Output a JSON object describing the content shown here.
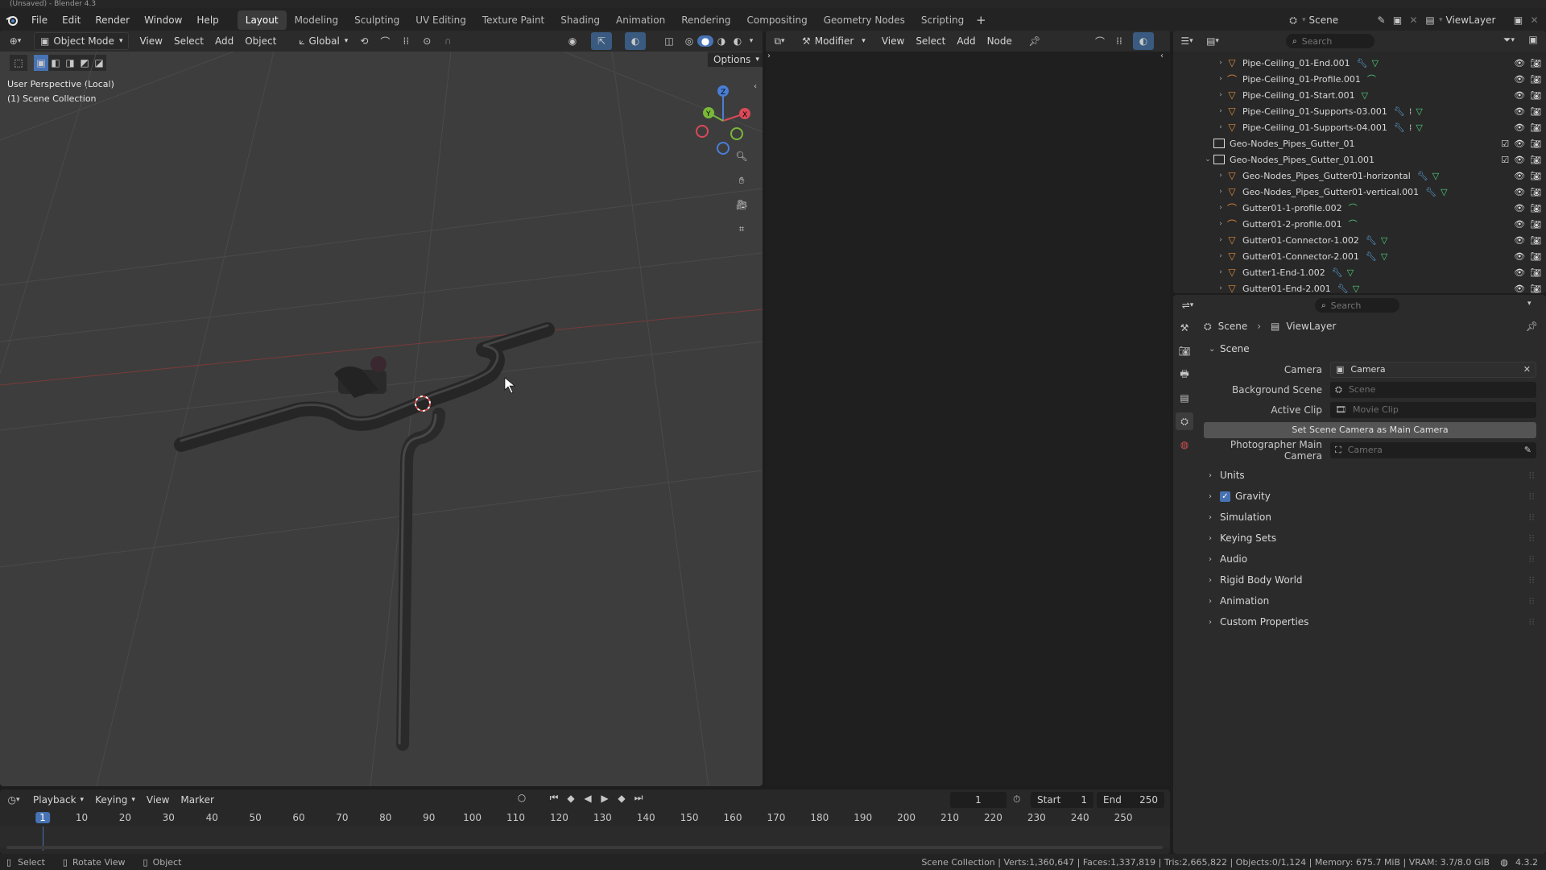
{
  "window": {
    "title": "(Unsaved) - Blender 4.3"
  },
  "topbar": {
    "menus": [
      "File",
      "Edit",
      "Render",
      "Window",
      "Help"
    ],
    "workspaces": [
      "Layout",
      "Modeling",
      "Sculpting",
      "UV Editing",
      "Texture Paint",
      "Shading",
      "Animation",
      "Rendering",
      "Compositing",
      "Geometry Nodes",
      "Scripting"
    ],
    "active_workspace": "Layout",
    "scene": "Scene",
    "view_layer": "ViewLayer"
  },
  "viewport": {
    "mode": "Object Mode",
    "menus": [
      "View",
      "Select",
      "Add",
      "Object"
    ],
    "orientation": "Global",
    "options_label": "Options",
    "overlay_line1": "User Perspective (Local)",
    "overlay_line2": "(1) Scene Collection"
  },
  "node_editor": {
    "type": "Modifier",
    "menus": [
      "View",
      "Select",
      "Add",
      "Node"
    ]
  },
  "outliner": {
    "search_placeholder": "Search",
    "rows": [
      {
        "name": "Pipe-Ceiling_01-End.001",
        "type": "mesh",
        "mods": "wrench,tri",
        "indent": 2
      },
      {
        "name": "Pipe-Ceiling_01-Profile.001",
        "type": "curve",
        "mods": "curve",
        "indent": 2
      },
      {
        "name": "Pipe-Ceiling_01-Start.001",
        "type": "mesh",
        "mods": "tri",
        "indent": 2
      },
      {
        "name": "Pipe-Ceiling_01-Supports-03.001",
        "type": "mesh",
        "mods": "wrench,grid,tri",
        "indent": 2
      },
      {
        "name": "Pipe-Ceiling_01-Supports-04.001",
        "type": "mesh",
        "mods": "wrench,grid,tri",
        "indent": 2
      },
      {
        "name": "Geo-Nodes_Pipes_Gutter_01",
        "type": "collection",
        "mods": "",
        "indent": 1
      },
      {
        "name": "Geo-Nodes_Pipes_Gutter_01.001",
        "type": "collection",
        "mods": "",
        "indent": 1
      },
      {
        "name": "Geo-Nodes_Pipes_Gutter01-horizontal",
        "type": "mesh",
        "mods": "wrench,tri",
        "indent": 2
      },
      {
        "name": "Geo-Nodes_Pipes_Gutter01-vertical.001",
        "type": "mesh",
        "mods": "wrench,tri",
        "indent": 2
      },
      {
        "name": "Gutter01-1-profile.002",
        "type": "curve",
        "mods": "curve",
        "indent": 2
      },
      {
        "name": "Gutter01-2-profile.001",
        "type": "curve",
        "mods": "curve",
        "indent": 2
      },
      {
        "name": "Gutter01-Connector-1.002",
        "type": "mesh",
        "mods": "wrench,tri",
        "indent": 2
      },
      {
        "name": "Gutter01-Connector-2.001",
        "type": "mesh",
        "mods": "wrench,tri",
        "indent": 2
      },
      {
        "name": "Gutter1-End-1.002",
        "type": "mesh",
        "mods": "wrench,tri",
        "indent": 2
      },
      {
        "name": "Gutter01-End-2.001",
        "type": "mesh",
        "mods": "wrench,tri",
        "indent": 2
      }
    ]
  },
  "properties": {
    "search_placeholder": "Search",
    "breadcrumb_scene": "Scene",
    "breadcrumb_layer": "ViewLayer",
    "section_title": "Scene",
    "camera_label": "Camera",
    "camera_value": "Camera",
    "background_scene_label": "Background Scene",
    "background_scene_placeholder": "Scene",
    "active_clip_label": "Active Clip",
    "active_clip_placeholder": "Movie Clip",
    "set_camera_button": "Set Scene Camera as Main Camera",
    "photographer_label": "Photographer Main Camera",
    "photographer_placeholder": "Camera",
    "panels": [
      "Units",
      "Gravity",
      "Simulation",
      "Keying Sets",
      "Audio",
      "Rigid Body World",
      "Animation",
      "Custom Properties"
    ],
    "gravity_checked": true
  },
  "timeline": {
    "menus": [
      "Playback",
      "Keying",
      "View",
      "Marker"
    ],
    "current_frame": "1",
    "start_label": "Start",
    "start_value": "1",
    "end_label": "End",
    "end_value": "250",
    "ticks": [
      "1",
      "10",
      "20",
      "30",
      "40",
      "50",
      "60",
      "70",
      "80",
      "90",
      "100",
      "110",
      "120",
      "130",
      "140",
      "150",
      "160",
      "170",
      "180",
      "190",
      "200",
      "210",
      "220",
      "230",
      "240",
      "250"
    ]
  },
  "statusbar": {
    "select": "Select",
    "rotate": "Rotate View",
    "object": "Object",
    "stats": "Scene Collection | Verts:1,360,647 | Faces:1,337,819 | Tris:2,665,822 | Objects:0/1,124 | Memory: 675.7 MiB | VRAM: 3.7/8.0 GiB",
    "version": "4.3.2"
  }
}
